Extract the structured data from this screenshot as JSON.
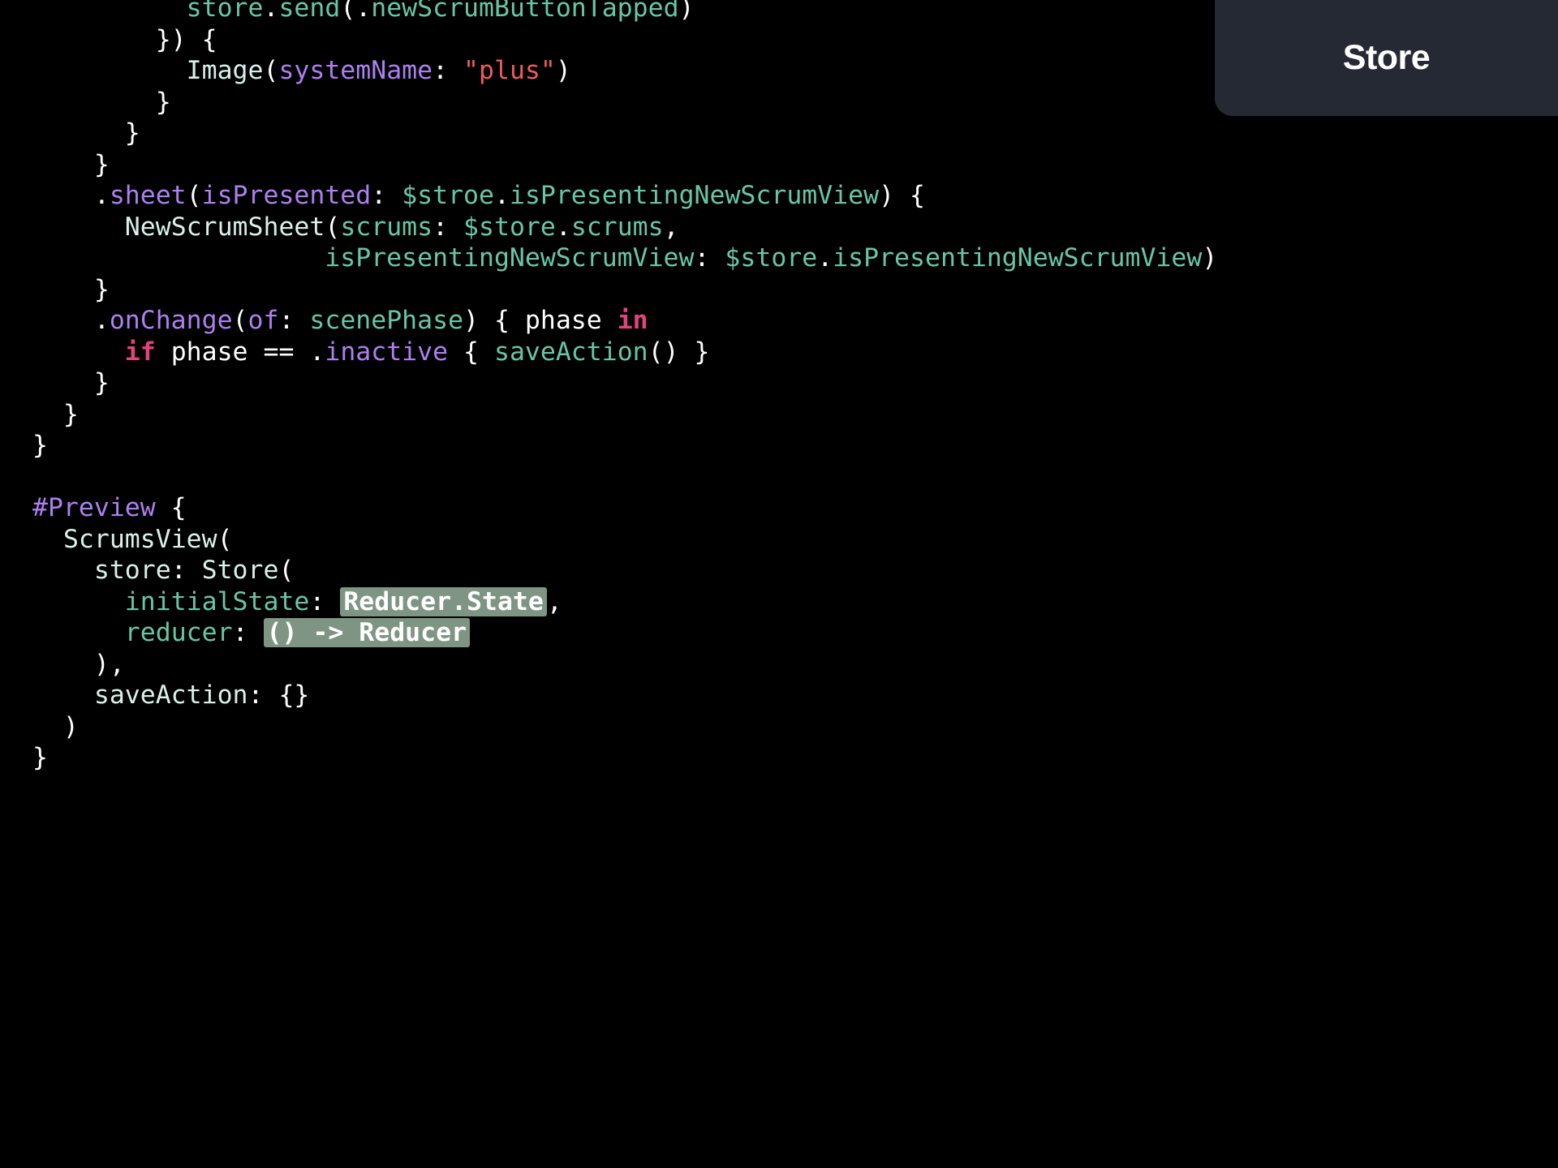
{
  "title_panel": {
    "title": "Store"
  },
  "editor": {
    "lines": [
      [
        {
          "t": "          ",
          "k": "plain"
        },
        {
          "t": "store",
          "k": "prop"
        },
        {
          "t": ".",
          "k": "plain"
        },
        {
          "t": "send",
          "k": "prop"
        },
        {
          "t": "(.",
          "k": "plain"
        },
        {
          "t": "newScrumButtonTapped",
          "k": "prop"
        },
        {
          "t": ")",
          "k": "plain"
        }
      ],
      [
        {
          "t": "        }) {",
          "k": "plain"
        }
      ],
      [
        {
          "t": "          ",
          "k": "plain"
        },
        {
          "t": "Image",
          "k": "type"
        },
        {
          "t": "(",
          "k": "plain"
        },
        {
          "t": "systemName",
          "k": "param"
        },
        {
          "t": ": ",
          "k": "plain"
        },
        {
          "t": "\"plus\"",
          "k": "str"
        },
        {
          "t": ")",
          "k": "plain"
        }
      ],
      [
        {
          "t": "        }",
          "k": "plain"
        }
      ],
      [
        {
          "t": "      }",
          "k": "plain"
        }
      ],
      [
        {
          "t": "    }",
          "k": "plain"
        }
      ],
      [
        {
          "t": "    .",
          "k": "plain"
        },
        {
          "t": "sheet",
          "k": "fn"
        },
        {
          "t": "(",
          "k": "plain"
        },
        {
          "t": "isPresented",
          "k": "param"
        },
        {
          "t": ": ",
          "k": "plain"
        },
        {
          "t": "$stroe",
          "k": "prop"
        },
        {
          "t": ".",
          "k": "plain"
        },
        {
          "t": "isPresentingNewScrumView",
          "k": "prop"
        },
        {
          "t": ") {",
          "k": "plain"
        }
      ],
      [
        {
          "t": "      ",
          "k": "plain"
        },
        {
          "t": "NewScrumSheet",
          "k": "type"
        },
        {
          "t": "(",
          "k": "plain"
        },
        {
          "t": "scrums",
          "k": "prop"
        },
        {
          "t": ": ",
          "k": "plain"
        },
        {
          "t": "$store",
          "k": "prop"
        },
        {
          "t": ".",
          "k": "plain"
        },
        {
          "t": "scrums",
          "k": "prop"
        },
        {
          "t": ",",
          "k": "plain"
        }
      ],
      [
        {
          "t": "                   ",
          "k": "plain"
        },
        {
          "t": "isPresentingNewScrumView",
          "k": "prop"
        },
        {
          "t": ": ",
          "k": "plain"
        },
        {
          "t": "$store",
          "k": "prop"
        },
        {
          "t": ".",
          "k": "plain"
        },
        {
          "t": "isPresentingNewScrumView",
          "k": "prop"
        },
        {
          "t": ")",
          "k": "plain"
        }
      ],
      [
        {
          "t": "    }",
          "k": "plain"
        }
      ],
      [
        {
          "t": "    .",
          "k": "plain"
        },
        {
          "t": "onChange",
          "k": "fn"
        },
        {
          "t": "(",
          "k": "plain"
        },
        {
          "t": "of",
          "k": "param"
        },
        {
          "t": ": ",
          "k": "plain"
        },
        {
          "t": "scenePhase",
          "k": "prop"
        },
        {
          "t": ") { phase ",
          "k": "plain"
        },
        {
          "t": "in",
          "k": "kw"
        }
      ],
      [
        {
          "t": "      ",
          "k": "plain"
        },
        {
          "t": "if",
          "k": "kw"
        },
        {
          "t": " phase == .",
          "k": "plain"
        },
        {
          "t": "inactive",
          "k": "fn"
        },
        {
          "t": " { ",
          "k": "plain"
        },
        {
          "t": "saveAction",
          "k": "prop"
        },
        {
          "t": "() }",
          "k": "plain"
        }
      ],
      [
        {
          "t": "    }",
          "k": "plain"
        }
      ],
      [
        {
          "t": "  }",
          "k": "plain"
        }
      ],
      [
        {
          "t": "}",
          "k": "plain"
        }
      ],
      [
        {
          "t": "",
          "k": "plain"
        }
      ],
      [
        {
          "t": "#Preview",
          "k": "directive"
        },
        {
          "t": " {",
          "k": "plain"
        }
      ],
      [
        {
          "t": "  ",
          "k": "plain"
        },
        {
          "t": "ScrumsView",
          "k": "type"
        },
        {
          "t": "(",
          "k": "plain"
        }
      ],
      [
        {
          "t": "    ",
          "k": "plain"
        },
        {
          "t": "store",
          "k": "type"
        },
        {
          "t": ": ",
          "k": "plain"
        },
        {
          "t": "Store",
          "k": "type"
        },
        {
          "t": "(",
          "k": "plain"
        }
      ],
      [
        {
          "t": "      ",
          "k": "plain"
        },
        {
          "t": "initialState",
          "k": "prop"
        },
        {
          "t": ": ",
          "k": "plain"
        },
        {
          "t": "Reducer.State",
          "k": "placeholder"
        },
        {
          "t": ",",
          "k": "plain"
        }
      ],
      [
        {
          "t": "      ",
          "k": "plain"
        },
        {
          "t": "reducer",
          "k": "prop"
        },
        {
          "t": ": ",
          "k": "plain"
        },
        {
          "t": "() -> Reducer",
          "k": "placeholder"
        }
      ],
      [
        {
          "t": "    ),",
          "k": "plain"
        }
      ],
      [
        {
          "t": "    ",
          "k": "plain"
        },
        {
          "t": "saveAction",
          "k": "type"
        },
        {
          "t": ": {}",
          "k": "plain"
        }
      ],
      [
        {
          "t": "  )",
          "k": "plain"
        }
      ],
      [
        {
          "t": "}",
          "k": "plain"
        }
      ]
    ]
  }
}
